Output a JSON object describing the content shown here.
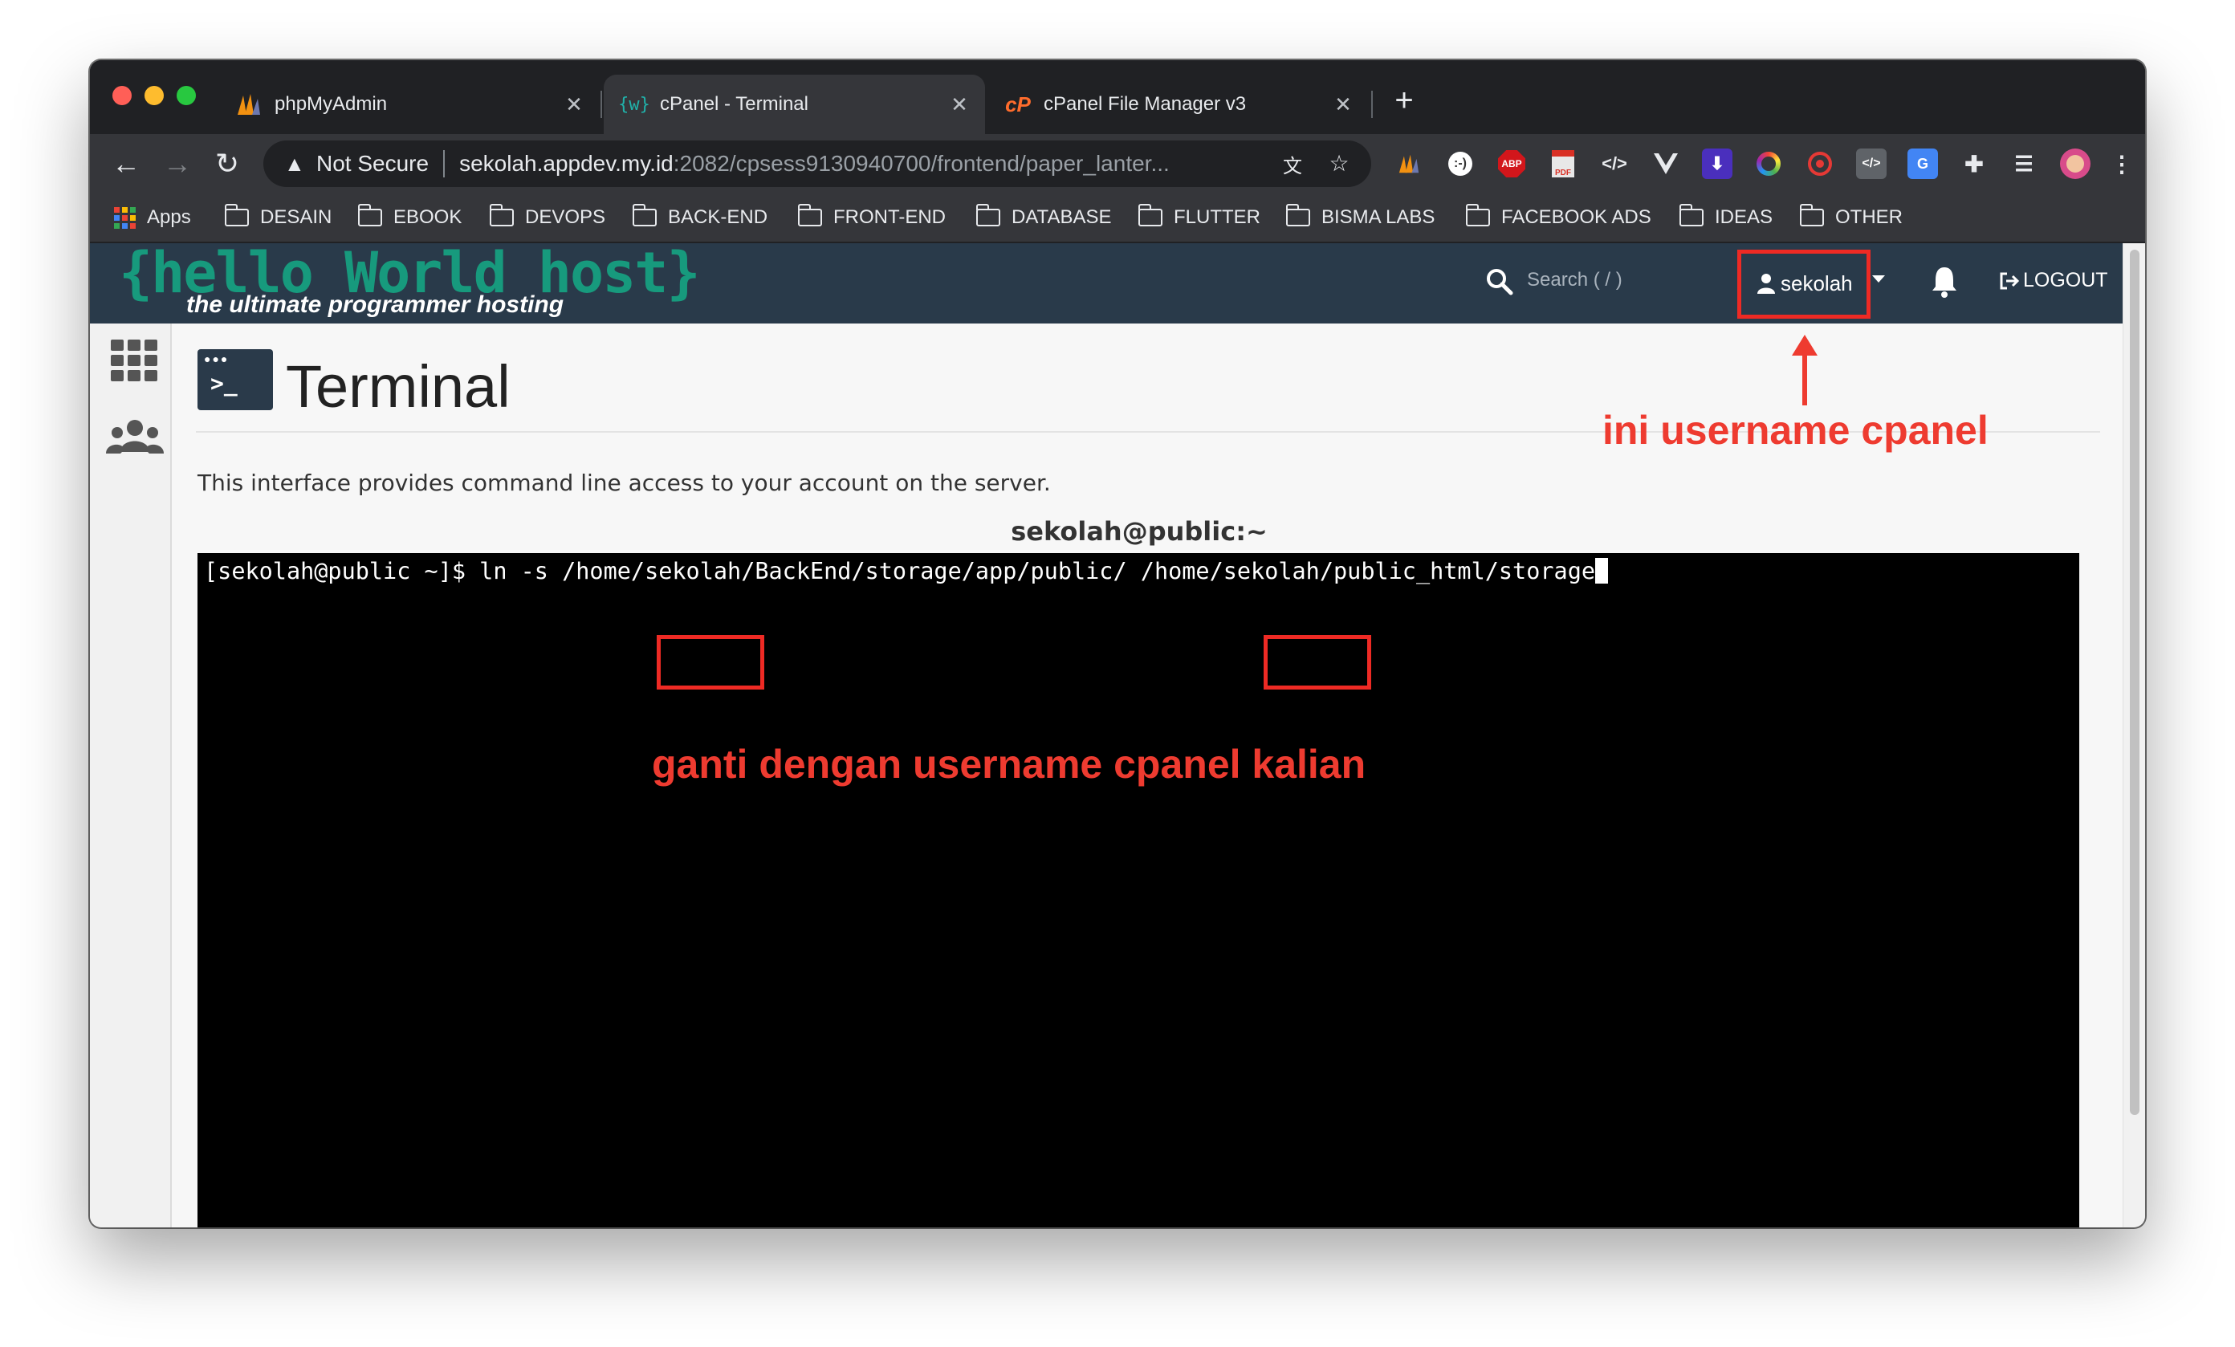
{
  "browser": {
    "tabs": [
      {
        "title": "phpMyAdmin",
        "favicon": "phpmyadmin-sail-icon",
        "active": false
      },
      {
        "title": "cPanel - Terminal",
        "favicon": "terminal-braces-icon",
        "active": true
      },
      {
        "title": "cPanel File Manager v3",
        "favicon": "cpanel-icon",
        "active": false
      }
    ],
    "address": {
      "security_label": "Not Secure",
      "host": "sekolah.appdev.my.id",
      "path": ":2082/cpsess9130940700/frontend/paper_lanter..."
    },
    "bookmarks": [
      "Apps",
      "DESAIN",
      "EBOOK",
      "DEVOPS",
      "BACK-END",
      "FRONT-END",
      "DATABASE",
      "FLUTTER",
      "BISMA LABS",
      "FACEBOOK ADS",
      "IDEAS",
      "OTHER"
    ],
    "extension_labels": {
      "abp": "ABP",
      "pdf": "PDF"
    }
  },
  "cpanel": {
    "logo_main": "{hello World host}",
    "logo_sub": "the ultimate programmer hosting",
    "search_placeholder": "Search ( / )",
    "username": "sekolah",
    "logout_label": "LOGOUT"
  },
  "page": {
    "title": "Terminal",
    "description": "This interface provides command line access to your account on the server.",
    "terminal_title": "sekolah@public:~",
    "command_parts": {
      "prompt": "[sekolah@public ~]$ ln -s /home/",
      "user1": "sekolah",
      "mid": "/BackEnd/storage/app/public/ /home/",
      "user2": "sekolah",
      "tail": "/public_html/storage"
    }
  },
  "annotations": {
    "username_note": "ini username cpanel",
    "replace_note": "ganti dengan username cpanel kalian"
  },
  "colors": {
    "cpanel_header": "#293a4a",
    "logo_teal": "#179a7d",
    "annotation_red": "#ee3b30",
    "chrome_dark": "#202124",
    "chrome_toolbar": "#35363a"
  }
}
